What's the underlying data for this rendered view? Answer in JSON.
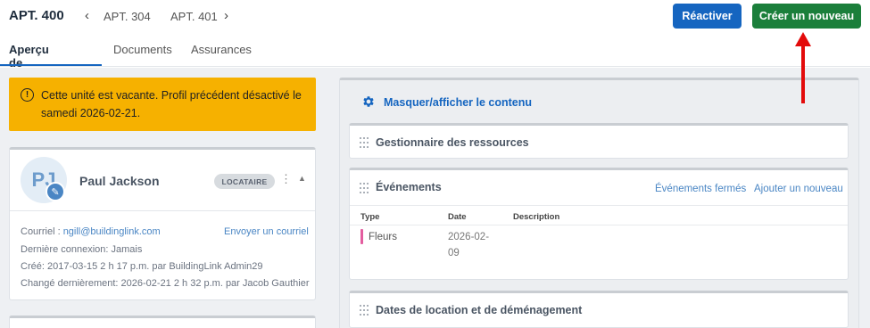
{
  "header": {
    "unit_title": "APT. 400",
    "prev_unit": "APT. 304",
    "next_unit": "APT. 401",
    "reactivate_label": "Réactiver",
    "create_label": "Créer un nouveau"
  },
  "tabs": [
    "Aperçu de l'unité",
    "Documents",
    "Assurances"
  ],
  "alert": {
    "icon": "exclamation-circle-icon",
    "text": "Cette unité est vacante. Profil précédent désactivé le samedi 2026-02-21."
  },
  "contact": {
    "initials": "PJ",
    "name": "Paul Jackson",
    "role": "LOCATAIRE",
    "email_label": "Courriel :",
    "email": "ngill@buildinglink.com",
    "send_email": "Envoyer un courriel",
    "last_login_label": "Dernière connexion:",
    "last_login": "Jamais",
    "created_label": "Créé:",
    "created": "2017-03-15 2 h 17 p.m. par BuildingLink Admin29",
    "modified_label": "Changé dernièrement:",
    "modified": "2026-02-21 2 h 32 p.m. par Jacob Gauthier"
  },
  "right": {
    "toggle_label": "Masquer/afficher le contenu",
    "resources_title": "Gestionnaire des ressources",
    "events": {
      "title": "Événements",
      "closed_link": "Événements fermés",
      "add_link": "Ajouter un nouveau",
      "columns": [
        "Type",
        "Date",
        "Description"
      ],
      "row": {
        "type": "Fleurs",
        "date": "2026-02-09",
        "description": ""
      },
      "marker_color": "#e35d9f"
    },
    "dates_title": "Dates de location et de déménagement"
  },
  "colors": {
    "primary": "#1565c0",
    "success": "#1b7f3b",
    "warning": "#f6b100",
    "annotation_arrow": "#e30b0b"
  }
}
